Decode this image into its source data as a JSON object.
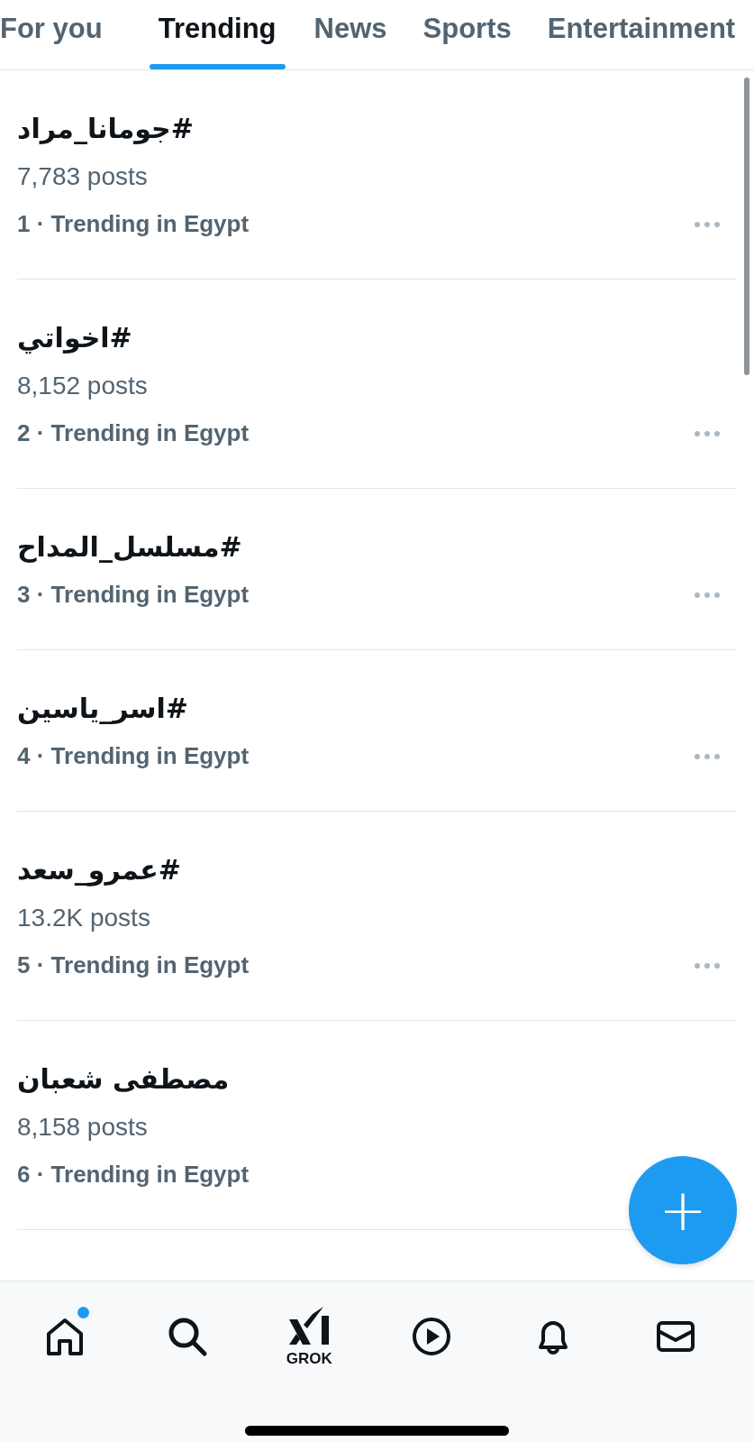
{
  "tabs": [
    {
      "label": "For you",
      "selected": false
    },
    {
      "label": "Trending",
      "selected": true
    },
    {
      "label": "News",
      "selected": false
    },
    {
      "label": "Sports",
      "selected": false
    },
    {
      "label": "Entertainment",
      "selected": false
    }
  ],
  "trends": [
    {
      "title": "#جومانا_مراد",
      "posts": "7,783 posts",
      "meta": "1 · Trending in Egypt"
    },
    {
      "title": "#اخواتي",
      "posts": "8,152 posts",
      "meta": "2 · Trending in Egypt"
    },
    {
      "title": "#مسلسل_المداح",
      "meta": "3 · Trending in Egypt"
    },
    {
      "title": "#اسر_ياسين",
      "meta": "4 · Trending in Egypt"
    },
    {
      "title": "#عمرو_سعد",
      "posts": "13.2K posts",
      "meta": "5 · Trending in Egypt"
    },
    {
      "title": "مصطفى شعبان",
      "posts": "8,158 posts",
      "meta": "6 · Trending in Egypt",
      "more_hidden": true
    }
  ],
  "compose_button": {
    "label": "+"
  },
  "bottom_nav": [
    {
      "kind": "home",
      "dot": true
    },
    {
      "kind": "search",
      "dot": false
    },
    {
      "kind": "grok",
      "label": "GROK",
      "dot": false
    },
    {
      "kind": "video",
      "dot": false
    },
    {
      "kind": "notifications",
      "dot": false
    },
    {
      "kind": "messages",
      "dot": false
    }
  ]
}
